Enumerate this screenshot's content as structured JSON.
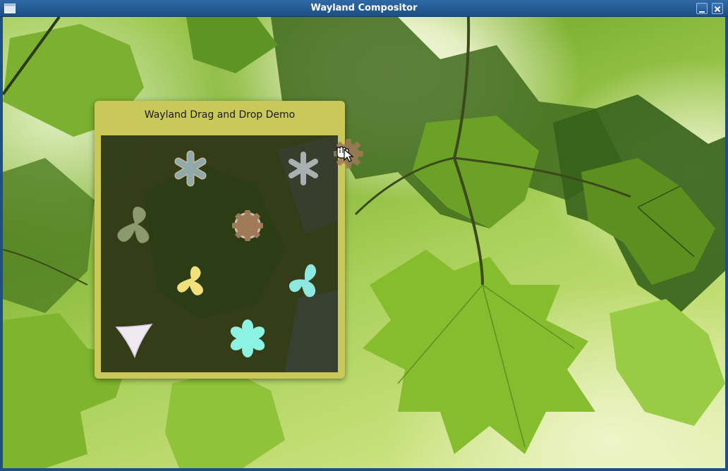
{
  "window": {
    "title": "Wayland Compositor",
    "minimize_label": "_",
    "close_label": "✕",
    "app_icon": "window-icon"
  },
  "demo": {
    "title": "Wayland Drag and Drop Demo",
    "items": [
      {
        "shape": "asterisk",
        "color": "#8faaa8",
        "outline": "#c8b8a0"
      },
      {
        "shape": "asterisk",
        "color": "#aab0b2",
        "outline": "#9aa0a2"
      },
      {
        "shape": "trefoil",
        "color": "#8a9a6c",
        "outline": "#7a8a5c"
      },
      {
        "shape": "gear",
        "color": "#a07a58",
        "outline": "#c8c0b0"
      },
      {
        "shape": "trefoil",
        "color": "#f2e07a",
        "outline": "#e8d070"
      },
      {
        "shape": "trefoil",
        "color": "#8ee8e2",
        "outline": "#7ed8d2"
      },
      {
        "shape": "triangle",
        "color": "#eeeaf0",
        "outline": "#d8c8e0"
      },
      {
        "shape": "flower",
        "color": "#8cf2e2",
        "outline": "#7ce2d2"
      }
    ],
    "dragged_item": {
      "shape": "gear",
      "color": "#a07a58"
    }
  },
  "cursor": "grab-hand-icon"
}
